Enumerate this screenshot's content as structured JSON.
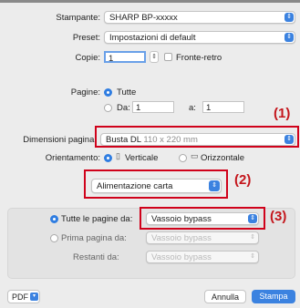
{
  "printer": {
    "label": "Stampante:",
    "value": "SHARP BP-xxxxx"
  },
  "preset": {
    "label": "Preset:",
    "value": "Impostazioni di default"
  },
  "copies": {
    "label": "Copie:",
    "value": "1",
    "duplex_label": "Fronte-retro"
  },
  "pages": {
    "label": "Pagine:",
    "all_label": "Tutte",
    "from_label": "Da:",
    "from_value": "1",
    "to_label": "a:",
    "to_value": "1"
  },
  "paper_size": {
    "label": "Dimensioni pagina:",
    "value": "Busta DL",
    "dims": "110 x 220 mm"
  },
  "orientation": {
    "label": "Orientamento:",
    "portrait": "Verticale",
    "landscape": "Orizzontale"
  },
  "section_popup": {
    "value": "Alimentazione carta"
  },
  "feed": {
    "all_pages_label": "Tutte le pagine da:",
    "all_pages_value": "Vassoio bypass",
    "first_page_label": "Prima pagina da:",
    "first_page_value": "Vassoio bypass",
    "remaining_label": "Restanti da:",
    "remaining_value": "Vassoio bypass"
  },
  "callouts": {
    "c1": "(1)",
    "c2": "(2)",
    "c3": "(3)"
  },
  "footer": {
    "pdf_label": "PDF",
    "cancel_label": "Annulla",
    "print_label": "Stampa"
  },
  "colors": {
    "accent": "#2f7de1",
    "highlight": "#d0021b"
  }
}
